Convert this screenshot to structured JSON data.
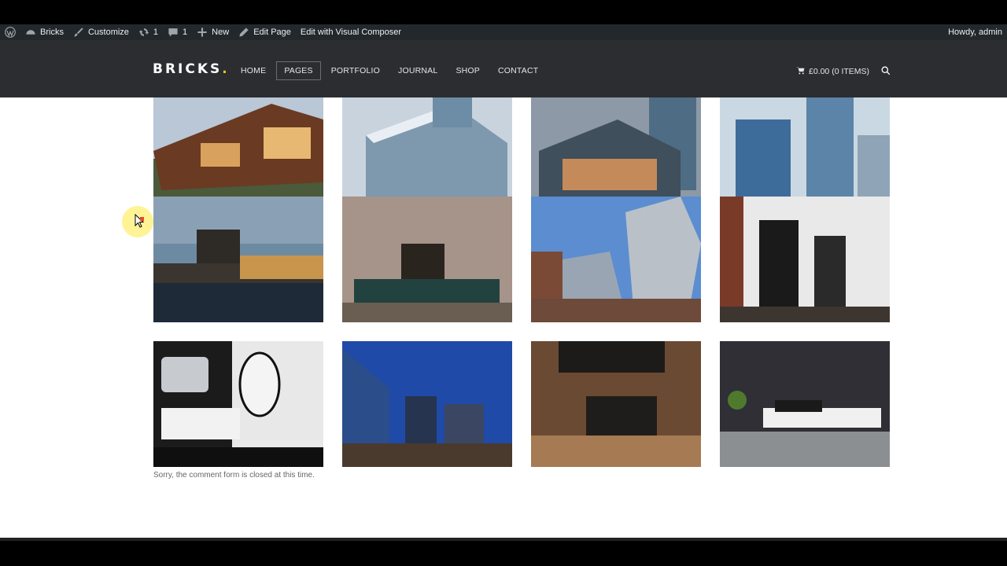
{
  "adminbar": {
    "items": [
      {
        "icon": "wordpress-icon",
        "label": ""
      },
      {
        "icon": "dashboard-icon",
        "label": "Bricks"
      },
      {
        "icon": "brush-icon",
        "label": "Customize"
      },
      {
        "icon": "update-icon",
        "label": "1"
      },
      {
        "icon": "comment-icon",
        "label": "1"
      },
      {
        "icon": "plus-icon",
        "label": "New"
      },
      {
        "icon": "edit-icon",
        "label": "Edit Page"
      },
      {
        "icon": "",
        "label": "Edit with Visual Composer"
      }
    ],
    "greeting": "Howdy, admin"
  },
  "header": {
    "logo": "BRICKS",
    "logo_dot": ".",
    "nav": [
      {
        "label": "HOME",
        "active": false
      },
      {
        "label": "PAGES",
        "active": true
      },
      {
        "label": "PORTFOLIO",
        "active": false
      },
      {
        "label": "JOURNAL",
        "active": false
      },
      {
        "label": "SHOP",
        "active": false
      },
      {
        "label": "CONTACT",
        "active": false
      }
    ],
    "cart": "£0.00 (0 ITEMS)",
    "accent_color": "#f2c31a"
  },
  "gallery": {
    "images": [
      {
        "name": "wooden-house-photo"
      },
      {
        "name": "glass-office-building-photo"
      },
      {
        "name": "glass-facade-building-photo"
      },
      {
        "name": "blue-office-towers-photo"
      },
      {
        "name": "night-waterfront-building-photo"
      },
      {
        "name": "brick-loft-living-room-photo"
      },
      {
        "name": "deconstructivist-building-photo"
      },
      {
        "name": "loft-interior-black-white-photo"
      },
      {
        "name": "bathroom-mural-photo"
      },
      {
        "name": "city-skyline-dusk-photo"
      },
      {
        "name": "leather-chair-interior-photo"
      },
      {
        "name": "white-sofa-dark-wall-photo"
      }
    ]
  },
  "comments": {
    "closed_message": "Sorry, the comment form is closed at this time."
  }
}
